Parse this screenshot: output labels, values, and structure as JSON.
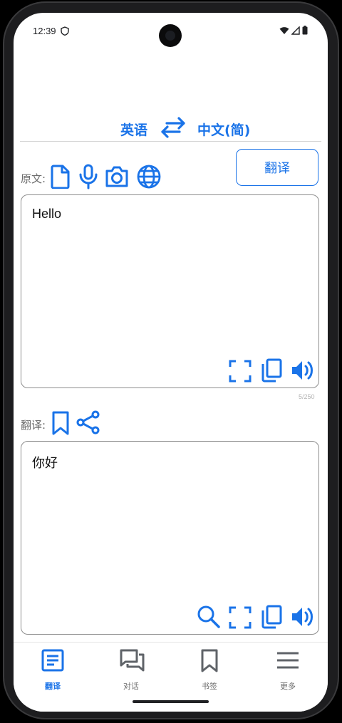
{
  "status_bar": {
    "time": "12:39"
  },
  "language_bar": {
    "source_language": "英语",
    "target_language": "中文(简)"
  },
  "source": {
    "label": "原文:",
    "text": "Hello",
    "char_count": "5/250",
    "toolbar_icons": [
      "document-icon",
      "microphone-icon",
      "camera-icon",
      "globe-icon"
    ],
    "action_icons": [
      "fullscreen-icon",
      "copy-icon",
      "speaker-icon"
    ]
  },
  "translate_button": {
    "label": "翻译"
  },
  "target": {
    "label": "翻译:",
    "text": "你好",
    "toolbar_icons": [
      "bookmark-icon",
      "share-icon"
    ],
    "action_icons": [
      "search-icon",
      "fullscreen-icon",
      "copy-icon",
      "speaker-icon"
    ]
  },
  "bottom_nav": {
    "items": [
      {
        "label": "翻译",
        "icon": "document-icon",
        "active": true
      },
      {
        "label": "对话",
        "icon": "chat-icon",
        "active": false
      },
      {
        "label": "书签",
        "icon": "bookmark-icon",
        "active": false
      },
      {
        "label": "更多",
        "icon": "menu-icon",
        "active": false
      }
    ]
  },
  "colors": {
    "accent": "#1a73e8",
    "label_gray": "#6b6b6b",
    "border": "#8e8e8e"
  }
}
